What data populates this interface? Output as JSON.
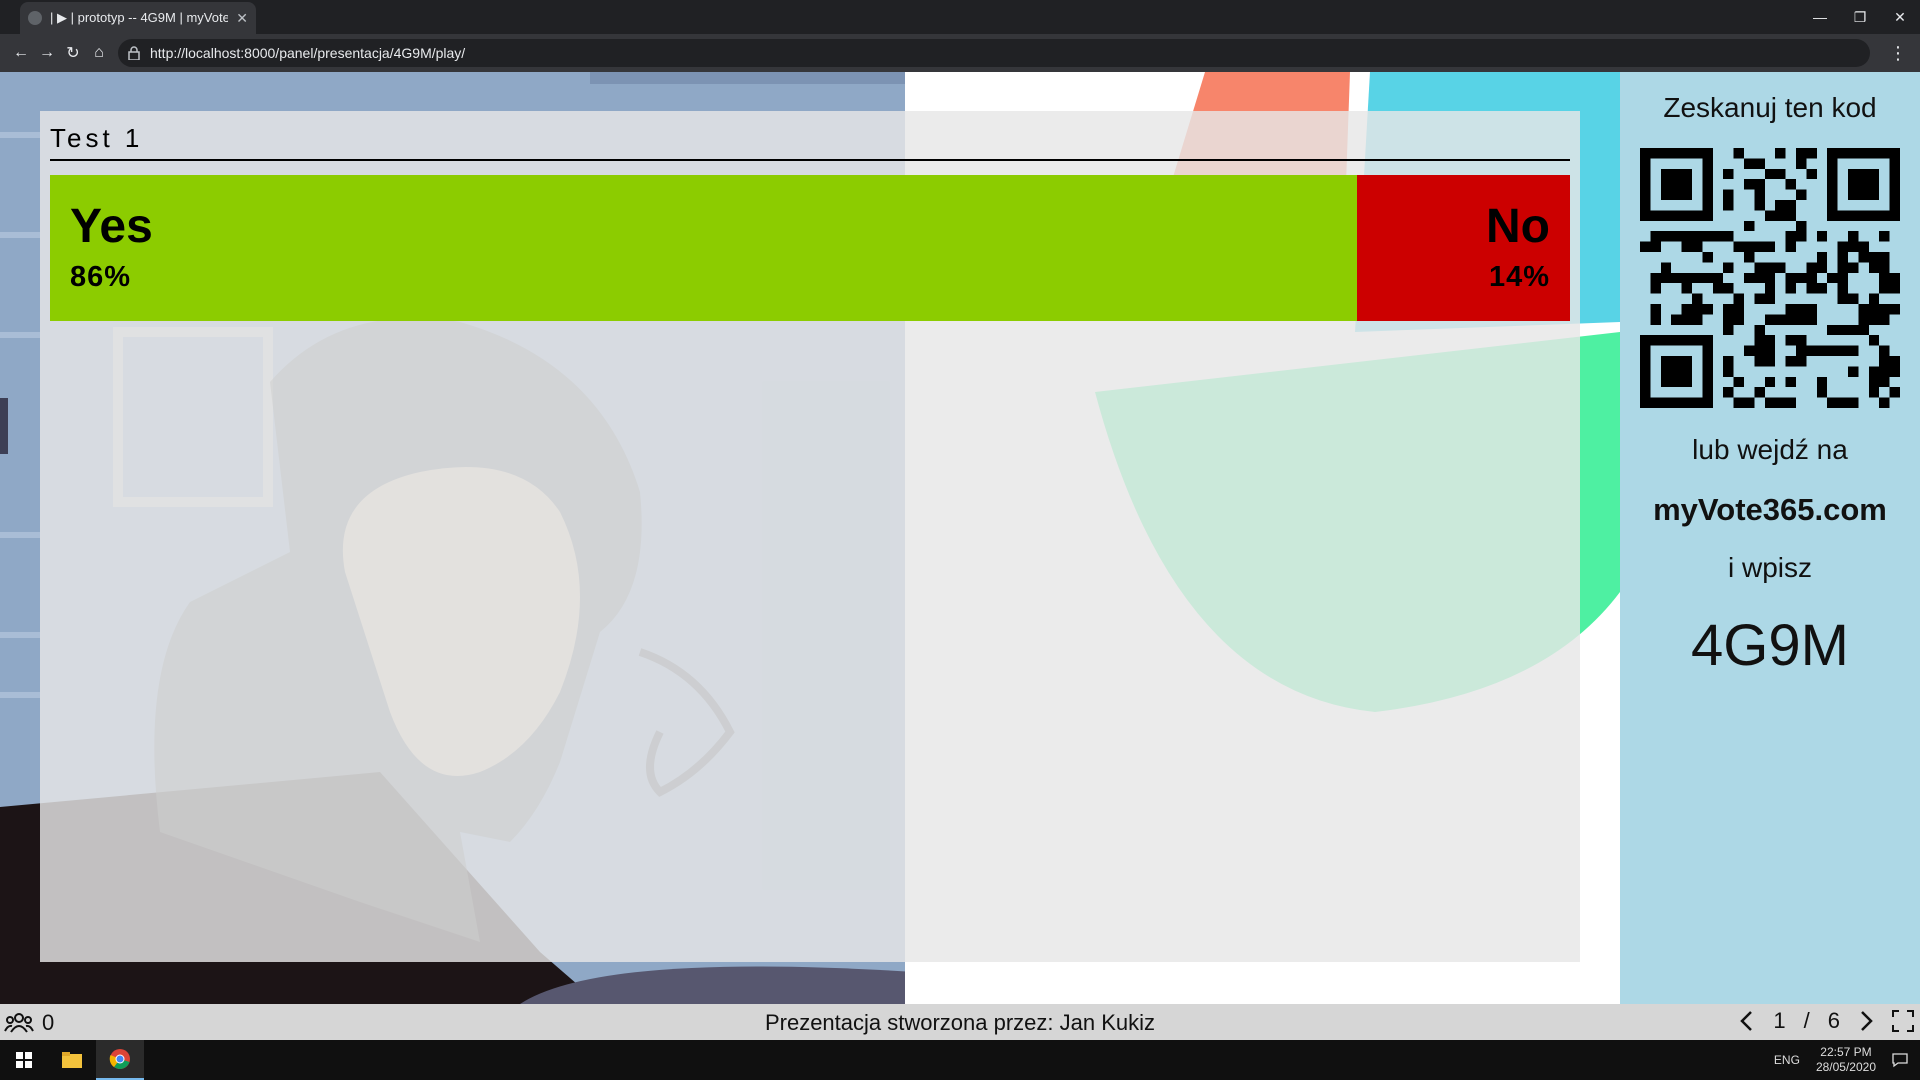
{
  "browser": {
    "tab_title": "| ▶ | prototyp -- 4G9M | myVote365",
    "address": "http://localhost:8000/panel/presentacja/4G9M/play/"
  },
  "question": {
    "title": "Test 1",
    "options": [
      {
        "label": "Yes",
        "percent_text": "86%",
        "percent": 86,
        "color": "#8ccc00"
      },
      {
        "label": "No",
        "percent_text": "14%",
        "percent": 14,
        "color": "#cc0000"
      }
    ]
  },
  "side_panel": {
    "scan_text": "Zeskanuj ten kod",
    "or_text": "lub wejdź na",
    "site": "myVote365.com",
    "enter_text": "i wpisz",
    "code": "4G9M",
    "background": "#add8e6"
  },
  "status": {
    "participants": "0",
    "credit": "Prezentacja stworzona przez: Jan Kukiz",
    "current_slide": "1",
    "slide_separator": "/",
    "total_slides": "6"
  },
  "taskbar": {
    "lang": "ENG",
    "time": "22:57 PM",
    "date": "28/05/2020"
  },
  "icons": [
    "globe-icon",
    "close-icon",
    "minimize-icon",
    "maximize-icon",
    "back-icon",
    "forward-icon",
    "reload-icon",
    "home-icon",
    "lock-icon",
    "menu-dots-icon",
    "users-icon",
    "prev-slide-icon",
    "next-slide-icon",
    "fullscreen-icon",
    "windows-start-icon",
    "file-explorer-icon",
    "chrome-icon",
    "notifications-icon"
  ]
}
